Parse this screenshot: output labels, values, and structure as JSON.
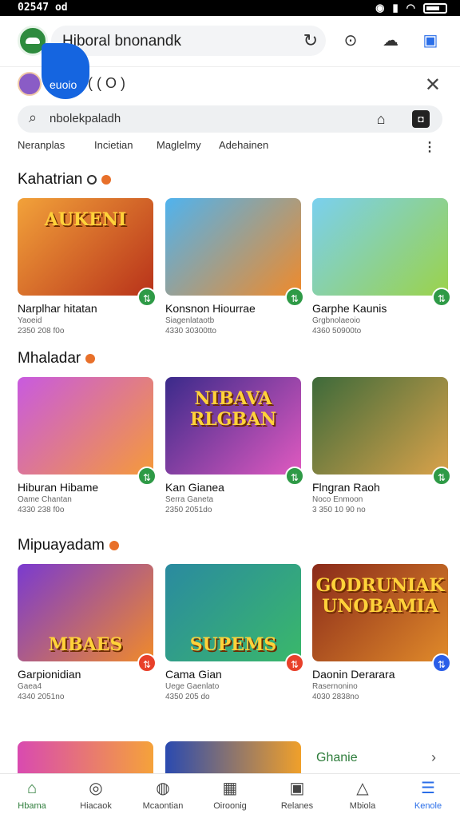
{
  "status": {
    "time": "02547 od"
  },
  "browser": {
    "url": "Hiboral bnonandk"
  },
  "profile": {
    "name": "euoio",
    "count": "( ( O )"
  },
  "search": {
    "query": "nbolekpaladh"
  },
  "chips": [
    "Neranplas",
    "Incietian",
    "Maglelmy",
    "Adehainen"
  ],
  "sections": [
    {
      "title": "Kahatrian",
      "cards": [
        {
          "name": "Narplhar hitatan",
          "meta1": "Yaoeid",
          "meta2": "2350 208 f0o",
          "caption": "AUKENI",
          "colors": [
            "#f2a23a",
            "#b8321a"
          ]
        },
        {
          "name": "Konsnon Hiourrae",
          "meta1": "Siagenlataotb",
          "meta2": "4330 30300tto",
          "caption": "",
          "colors": [
            "#4fb3ef",
            "#f08a2a"
          ]
        },
        {
          "name": "Garphe Kaunis",
          "meta1": "Grgbnolaeoio",
          "meta2": "4360 50900to",
          "caption": "",
          "colors": [
            "#7ad0ef",
            "#9bd24a"
          ]
        }
      ]
    },
    {
      "title": "Mhaladar",
      "cards": [
        {
          "name": "Hiburan Hibame",
          "meta1": "Oame Chantan",
          "meta2": "4330 238 f0o",
          "caption": "",
          "colors": [
            "#c85ae0",
            "#f59a3a"
          ]
        },
        {
          "name": "Kan Gianea",
          "meta1": "Serra Ganeta",
          "meta2": "2350 2051do",
          "caption": "NIBAVA RLGBAN",
          "colors": [
            "#3a2a8a",
            "#e05ac0"
          ]
        },
        {
          "name": "Flngran Raoh",
          "meta1": "Noco Enmoon",
          "meta2": "3 350 10 90 no",
          "caption": "",
          "colors": [
            "#3d6a3a",
            "#d9a24a"
          ]
        }
      ]
    },
    {
      "title": "Mipuayadam",
      "cards": [
        {
          "name": "Garpionidian",
          "meta1": "Gaea4",
          "meta2": "4340 2051no",
          "caption": "MBAES",
          "colors": [
            "#7a3ad0",
            "#f08a2a"
          ]
        },
        {
          "name": "Cama Gian",
          "meta1": "Uege Gaenlato",
          "meta2": "4350 205 do",
          "caption": "SUPEMS",
          "colors": [
            "#2a8aa0",
            "#3ab86a"
          ]
        },
        {
          "name": "Daonin Derarara",
          "meta1": "Rasernonino",
          "meta2": "4030 2838no",
          "caption": "GODRUNIAK UNOBAMIA",
          "colors": [
            "#8a2a1a",
            "#e08a2a"
          ]
        }
      ]
    }
  ],
  "peek_link": "Ghanie",
  "nav": [
    {
      "icon": "home-icon",
      "label": "Hbama"
    },
    {
      "icon": "search-icon",
      "label": "Hiacaok"
    },
    {
      "icon": "globe-icon",
      "label": "Mcaontian"
    },
    {
      "icon": "grid-icon",
      "label": "Oiroonig"
    },
    {
      "icon": "badge-icon",
      "label": "Relanes"
    },
    {
      "icon": "alert-icon",
      "label": "Mbiola"
    },
    {
      "icon": "menu-icon",
      "label": "Kenole"
    }
  ]
}
